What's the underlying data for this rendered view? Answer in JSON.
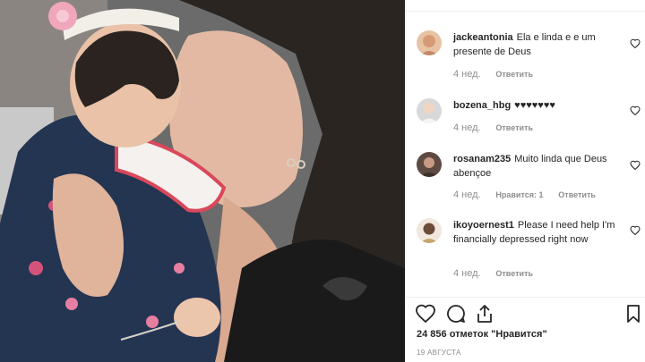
{
  "post": {
    "photo_label": "baby-and-mother-photo"
  },
  "comments": [
    {
      "username": "jackeantonia",
      "text": "Ela e linda e e um presente de Deus",
      "time": "4 нед.",
      "likes": "",
      "reply": "Ответить"
    },
    {
      "username": "bozena_hbg",
      "text": "♥♥♥♥♥♥♥",
      "time": "4 нед.",
      "likes": "",
      "reply": "Ответить"
    },
    {
      "username": "rosanam235",
      "text": "Muito linda que Deus abençoe",
      "time": "4 нед.",
      "likes": "Нравится: 1",
      "reply": "Ответить"
    },
    {
      "username": "ikoyoernest1",
      "text": "Please I need help I'm financially depressed right now",
      "time": "4 нед.",
      "likes": "",
      "reply": "Ответить"
    }
  ],
  "footer": {
    "likes_count": "24 856 отметок \"Нравится\"",
    "date": "19 АВГУСТА"
  },
  "icons": {
    "like": "heart-icon",
    "comment": "comment-icon",
    "share": "share-icon",
    "save": "bookmark-icon"
  }
}
